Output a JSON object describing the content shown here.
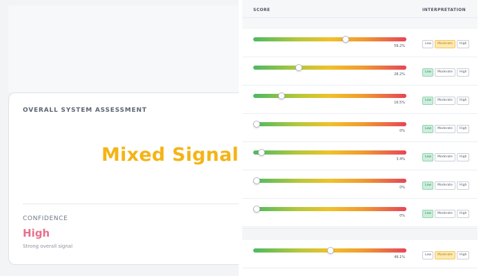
{
  "assessment": {
    "title": "OVERALL SYSTEM ASSESSMENT",
    "verdict": "Mixed Signals",
    "confidence_label": "CONFIDENCE",
    "confidence_value": "High",
    "confidence_note": "Strong overall signal"
  },
  "table": {
    "score_header": "SCORE",
    "interp_header": "INTERPRETATION",
    "tag_labels": [
      "Low",
      "Moderate",
      "High"
    ],
    "rows": [
      {
        "score": 0.592,
        "pct_label": "59.2%",
        "active": "Moderate"
      },
      {
        "score": 0.282,
        "pct_label": "28.2%",
        "active": "Low"
      },
      {
        "score": 0.165,
        "pct_label": "16.5%",
        "active": "Low"
      },
      {
        "score": 0.0,
        "pct_label": "0%",
        "active": "Low"
      },
      {
        "score": 0.034,
        "pct_label": "3.4%",
        "active": "Low"
      },
      {
        "score": 0.0,
        "pct_label": "0%",
        "active": "Low"
      },
      {
        "score": 0.0,
        "pct_label": "0%",
        "active": "Low"
      },
      {
        "score": 0.491,
        "pct_label": "49.1%",
        "active": "Moderate"
      }
    ]
  },
  "colors": {
    "verdict": "#f4b416",
    "confidence": "#e8708a",
    "low_active": "#cdeedd",
    "moderate_active": "#fde9b3"
  }
}
